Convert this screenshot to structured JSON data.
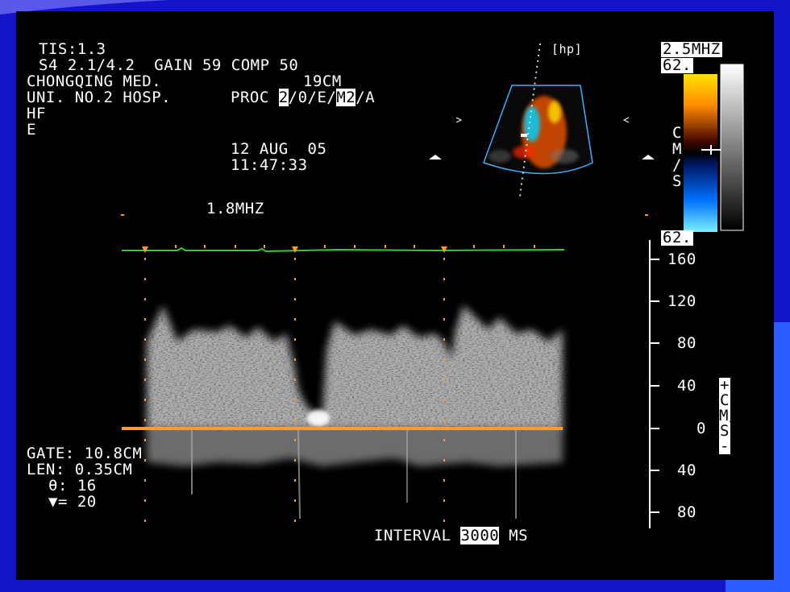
{
  "header": {
    "tis": "TIS:1.3",
    "probe_line": "S4 2.1/4.2  GAIN 59 COMP 50",
    "institution_line1": "CHONGQING MED.",
    "depth": "19CM",
    "institution_line2": "UNI. NO.2 HOSP.",
    "proc_label": "PROC ",
    "proc_value1": "2",
    "proc_mid": "/0/E/",
    "proc_value2": "M2",
    "proc_tail": "/A",
    "hf": "HF",
    "e": "E",
    "date": "12 AUG  05",
    "time": "11:47:33",
    "doppler_freq": "1.8MHZ"
  },
  "color_scale": {
    "freq": "2.5MHZ",
    "top_value": "62.",
    "bottom_value": "62.",
    "unit_letters": [
      "C",
      "M",
      "/",
      "S"
    ],
    "hp_label": "hp"
  },
  "velocity_scale": {
    "ticks": [
      "160",
      "120",
      "80",
      "40",
      "0",
      "40",
      "80"
    ],
    "unit": "+CM/S-"
  },
  "gate_info": {
    "gate": "GATE: 10.8CM",
    "len": "LEN: 0.35CM",
    "theta": "θ: 16",
    "tri": "▼= 20"
  },
  "interval": {
    "label": "INTERVAL ",
    "value": "3000",
    "unit": " MS"
  },
  "colors": {
    "slide_bg": "#1414c8",
    "baseline": "#ff9a33",
    "ecg": "#33cc33"
  }
}
